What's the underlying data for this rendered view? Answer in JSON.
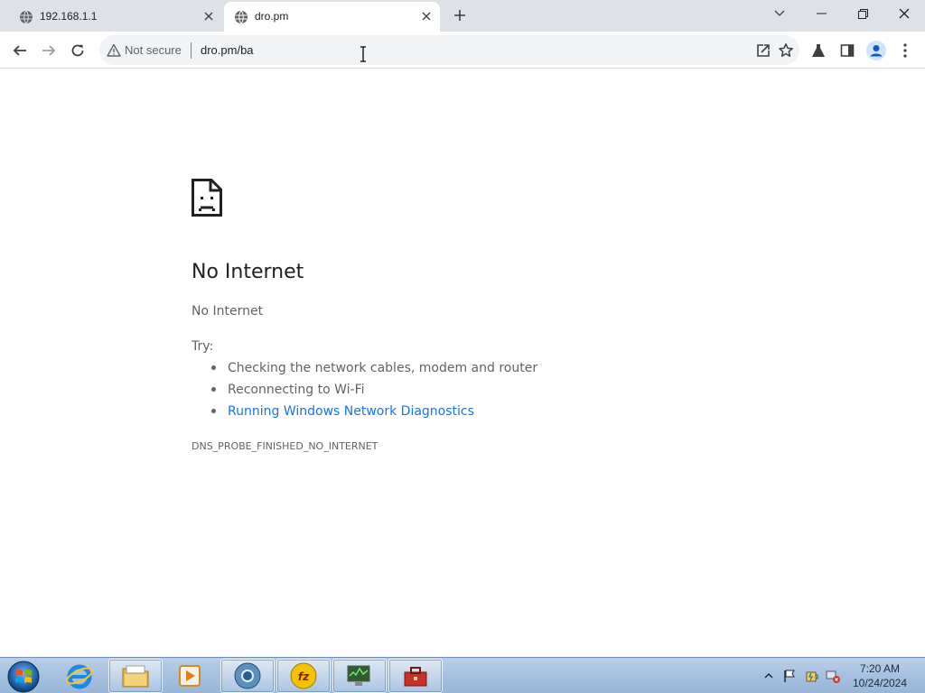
{
  "browser": {
    "tabs": [
      {
        "title": "192.168.1.1",
        "favicon": "globe-icon",
        "active": false
      },
      {
        "title": "dro.pm",
        "favicon": "globe-icon",
        "active": true
      }
    ],
    "new_tab_icon": "plus-icon",
    "window_controls": [
      "tab-search-chevron-icon",
      "minimize-icon",
      "restore-icon",
      "close-window-icon"
    ],
    "toolbar": {
      "back_icon": "back-arrow-icon",
      "forward_icon": "forward-arrow-icon",
      "reload_icon": "reload-icon",
      "security_label": "Not secure",
      "url": "dro.pm/ba",
      "right_icons": [
        "share-icon",
        "bookmark-star-icon",
        "extensions-flask-icon",
        "side-panel-icon",
        "profile-icon",
        "menu-kebab-icon"
      ]
    }
  },
  "error_page": {
    "icon": "sad-page-icon",
    "title": "No Internet",
    "subtitle": "No Internet",
    "try_label": "Try:",
    "suggestions": [
      {
        "text": "Checking the network cables, modem and router",
        "link": false
      },
      {
        "text": "Reconnecting to Wi-Fi",
        "link": false
      },
      {
        "text": "Running Windows Network Diagnostics",
        "link": true
      }
    ],
    "error_code": "DNS_PROBE_FINISHED_NO_INTERNET"
  },
  "taskbar": {
    "start_icon": "windows-start-orb-icon",
    "apps": [
      "internet-explorer-icon",
      "file-explorer-icon",
      "media-player-icon",
      "chrome-icon",
      "filezilla-icon",
      "network-monitor-icon",
      "toolbox-icon"
    ],
    "tray_icons": [
      "show-hidden-icons-chevron-icon",
      "action-center-flag-icon",
      "power-icon",
      "network-disconnected-icon"
    ],
    "clock": {
      "time": "7:20 AM",
      "date": "10/24/2024"
    }
  },
  "colors": {
    "tabstrip_bg": "#dee1e6",
    "link_blue": "#1a73e8",
    "text_primary": "#202124",
    "text_secondary": "#5f6368"
  }
}
